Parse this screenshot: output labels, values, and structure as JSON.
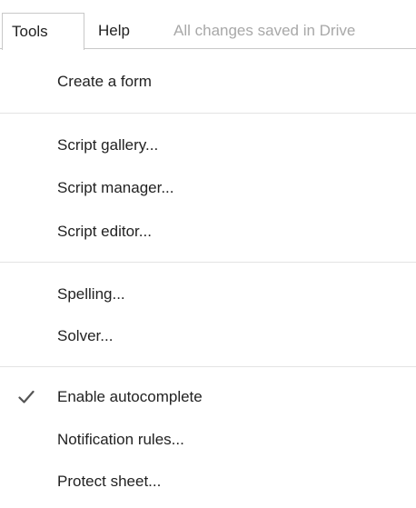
{
  "menubar": {
    "tools_label": "Tools",
    "help_label": "Help",
    "save_status": "All changes saved in Drive"
  },
  "menu": {
    "create_form": "Create a form",
    "script_gallery": "Script gallery...",
    "script_manager": "Script manager...",
    "script_editor": "Script editor...",
    "spelling": "Spelling...",
    "solver": "Solver...",
    "enable_autocomplete": "Enable autocomplete",
    "enable_autocomplete_checked": true,
    "notification_rules": "Notification rules...",
    "protect_sheet": "Protect sheet..."
  },
  "icons": {
    "checkmark": "check-icon"
  },
  "colors": {
    "text": "#222222",
    "status_text": "#a8a8a8",
    "separator": "#e3e3e3",
    "border": "#c8c8c8"
  }
}
